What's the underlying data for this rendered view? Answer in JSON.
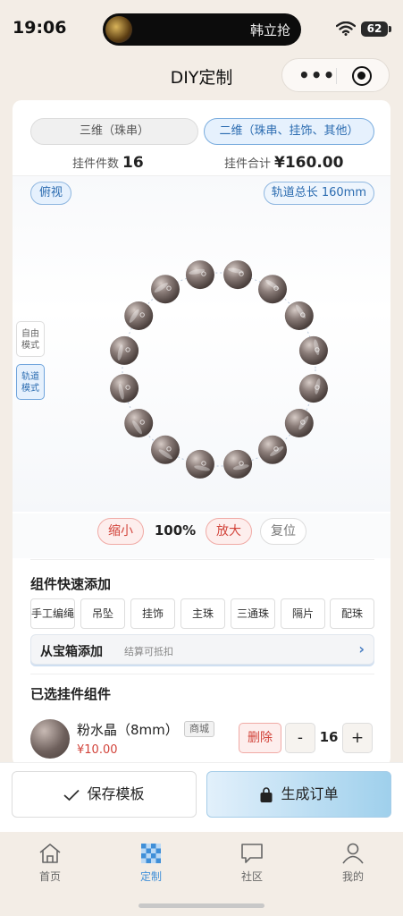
{
  "status": {
    "time": "19:06",
    "caller": "韩立抢",
    "battery": "62"
  },
  "nav": {
    "title": "DIY定制",
    "more_icon": "more-dots-icon",
    "close_icon": "mini-program-close-icon"
  },
  "modes": {
    "three_d": "三维（珠串）",
    "two_d": "二维（珠串、挂饰、其他）",
    "active": "two_d"
  },
  "summary": {
    "count_label": "挂件件数",
    "count": "16",
    "total_label": "挂件合计",
    "total": "¥160.00"
  },
  "stage": {
    "view_label": "俯视",
    "track_label": "轨道总长 160mm",
    "free_mode": "自由模式",
    "rail_mode": "轨道模式",
    "bead_count": 16
  },
  "zoom": {
    "out": "缩小",
    "level": "100%",
    "in": "放大",
    "reset": "复位"
  },
  "quick_add": {
    "title": "组件快速添加",
    "chips": [
      "手工编绳",
      "吊坠",
      "挂饰",
      "主珠",
      "三通珠",
      "隔片",
      "配珠"
    ],
    "treasure_title": "从宝箱添加",
    "treasure_sub": "结算可抵扣",
    "treasure_arrow": "›"
  },
  "selected": {
    "title": "已选挂件组件",
    "items": [
      {
        "name": "粉水晶（8mm）",
        "tag": "商城",
        "price": "¥10.00",
        "delete": "删除",
        "minus": "-",
        "qty": "16",
        "plus": "+"
      }
    ]
  },
  "actions": {
    "save": "保存模板",
    "order": "生成订单"
  },
  "tabs": [
    {
      "label": "首页",
      "icon": "home-icon"
    },
    {
      "label": "定制",
      "icon": "checker-icon",
      "active": true
    },
    {
      "label": "社区",
      "icon": "chat-icon"
    },
    {
      "label": "我的",
      "icon": "person-icon"
    }
  ],
  "colors": {
    "accent": "#3f8fd8",
    "danger": "#d2443b",
    "bead": "#8a7c78"
  }
}
